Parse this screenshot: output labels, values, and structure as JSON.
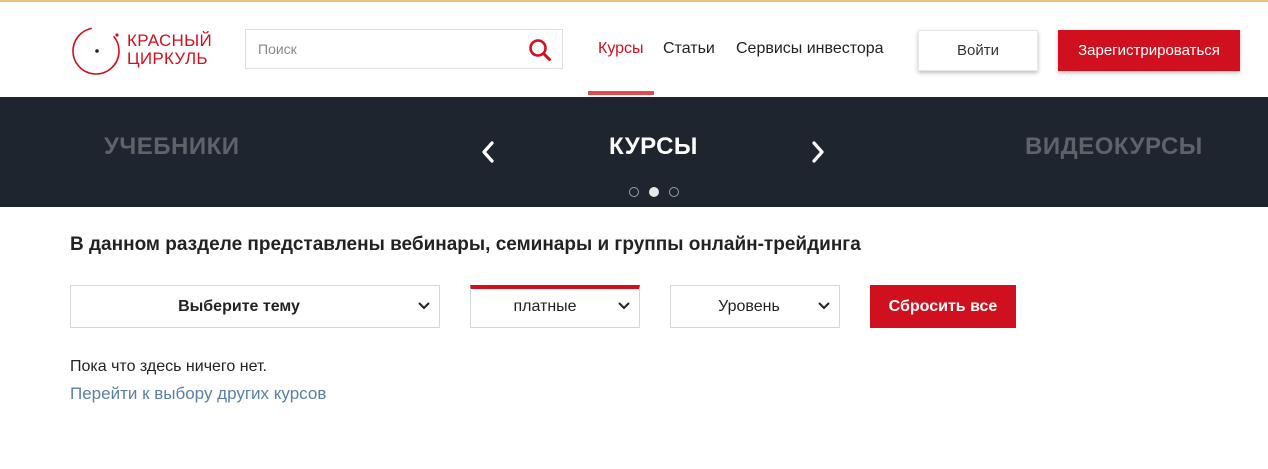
{
  "logo": {
    "line1": "КРАСНЫЙ",
    "line2": "ЦИРКУЛЬ",
    "icon": "compass-circle-logo"
  },
  "search": {
    "placeholder": "Поиск",
    "value": "",
    "icon": "search-icon"
  },
  "nav": [
    {
      "label": "Курсы",
      "active": true
    },
    {
      "label": "Статьи",
      "active": false
    },
    {
      "label": "Сервисы инвестора",
      "active": false
    }
  ],
  "auth": {
    "login_label": "Войти",
    "register_label": "Зарегистрироваться"
  },
  "carousel": {
    "prev_slide": "УЧЕБНИКИ",
    "current_slide": "КУРСЫ",
    "next_slide": "ВИДЕОКУРСЫ",
    "active_dot": 2,
    "dot_count": 3,
    "prev_icon": "chevron-left-icon",
    "next_icon": "chevron-right-icon"
  },
  "content": {
    "title": "В данном разделе представлены вебинары, семинары и группы онлайн-трейдинга",
    "filters": {
      "topic": "Выберите тему",
      "price": "платные",
      "level": "Уровень"
    },
    "reset_label": "Сбросить все",
    "empty_message": "Пока что здесь ничего нет.",
    "other_courses_link": "Перейти к выбору других курсов"
  },
  "colors": {
    "accent": "#d0101e",
    "band_bg": "#1f252e",
    "link": "#5a7fa5",
    "muted_slide": "#5f6369"
  }
}
